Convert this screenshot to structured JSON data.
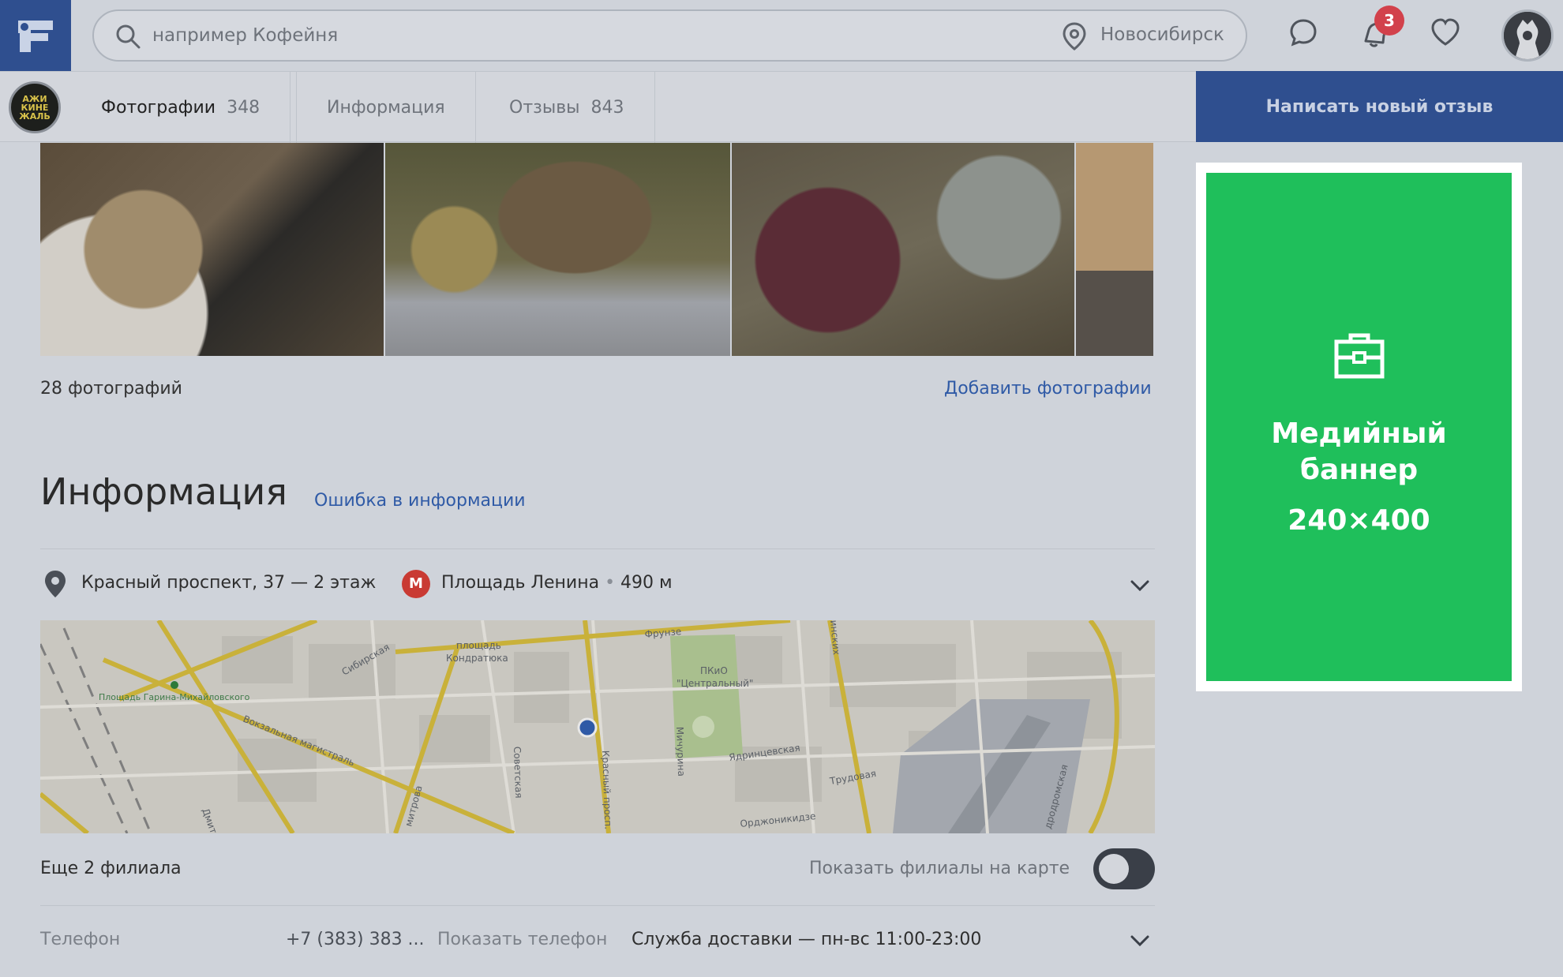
{
  "header": {
    "search_placeholder": "например Кофейня",
    "city": "Новосибирск",
    "notifications_count": "3"
  },
  "place": {
    "logo_text": "АЖИ КИНЕ ЖАЛЬ"
  },
  "tabs": [
    {
      "label": "Фотографии",
      "count": "348"
    },
    {
      "label": "Информация",
      "count": ""
    },
    {
      "label": "Отзывы",
      "count": "843"
    }
  ],
  "write_review_button": "Написать новый отзыв",
  "photos": {
    "count_text": "28 фотографий",
    "add_link": "Добавить фотографии"
  },
  "info": {
    "title": "Информация",
    "error_link": "Ошибка в информации",
    "address": "Красный проспект, 37 — 2 этаж",
    "metro_letter": "М",
    "metro_station": "Площадь Ленина",
    "metro_dot": "•",
    "metro_distance": "490 м",
    "branches": "Еще 2 филиала",
    "show_branches": "Показать филиалы на карте",
    "branches_toggle_on": false,
    "phone_label": "Телефон",
    "phone_value": "+7 (383) 383 ...",
    "show_phone": "Показать телефон",
    "delivery": "Служба доставки — пн-вс 11:00-23:00"
  },
  "map": {
    "labels": {
      "kondratyuk": [
        "площадь",
        "Кондратюка"
      ],
      "frunze": "Фрунзе",
      "pkio": [
        "ПКиО",
        "\"Центральный\""
      ],
      "sibirskaya": "Сибирская",
      "garina": "Площадь Гарина-Михайловского",
      "vokzalnaya": "Вокзальная магистраль",
      "sovetskaya": "Советская",
      "krasny": "Красный просп.",
      "michurina": "Мичурина",
      "yadrintsevskaya": "Ядринцевская",
      "trudovaya": "Трудовая",
      "ordzhonikidze": "Орджоникидзе",
      "dmitriya": "Дмитрия Ш.",
      "mitrova": "митрова",
      "inskaya": "инских",
      "aerodromnaya": "дродромская"
    }
  },
  "banner": {
    "title_line1": "Медийный",
    "title_line2": "баннер",
    "size": "240×400",
    "bg_color": "#1fbf5b"
  },
  "colors": {
    "brand": "#2f4f8f",
    "link": "#2f5aa6",
    "metro": "#c93a33",
    "badge": "#d2414b"
  }
}
